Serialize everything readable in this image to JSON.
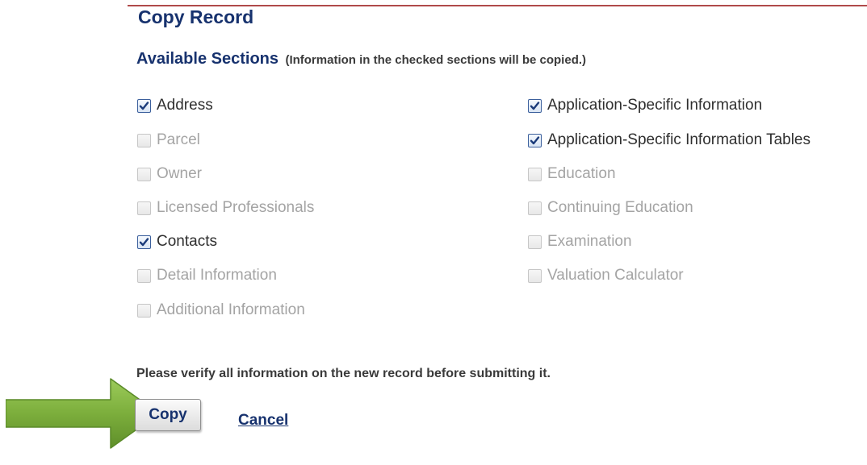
{
  "title": "Copy Record",
  "sections_header": {
    "title": "Available Sections",
    "note": "(Information in the checked sections will be copied.)"
  },
  "left_column": [
    {
      "label": "Address",
      "checked": true
    },
    {
      "label": "Parcel",
      "checked": false
    },
    {
      "label": "Owner",
      "checked": false
    },
    {
      "label": "Licensed Professionals",
      "checked": false
    },
    {
      "label": "Contacts",
      "checked": true
    },
    {
      "label": "Detail Information",
      "checked": false
    },
    {
      "label": "Additional Information",
      "checked": false
    }
  ],
  "right_column": [
    {
      "label": "Application-Specific Information",
      "checked": true
    },
    {
      "label": "Application-Specific Information Tables",
      "checked": true
    },
    {
      "label": "Education",
      "checked": false
    },
    {
      "label": "Continuing Education",
      "checked": false
    },
    {
      "label": "Examination",
      "checked": false
    },
    {
      "label": "Valuation Calculator",
      "checked": false
    }
  ],
  "verify_text": "Please verify all information on the new record before submitting it.",
  "actions": {
    "copy_label": "Copy",
    "cancel_label": "Cancel"
  },
  "colors": {
    "heading": "#17326e",
    "arrow": "#7cae3c",
    "checked_text": "#2f2f2f",
    "unchecked_text": "#a4a4a4"
  }
}
